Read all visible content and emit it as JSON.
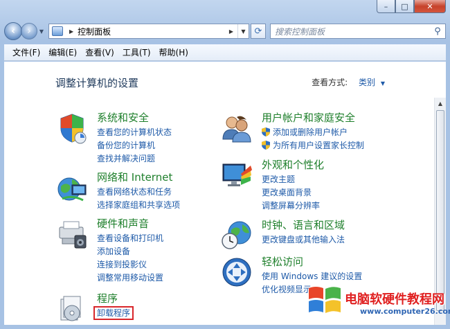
{
  "window": {
    "minimize_glyph": "–",
    "maximize_glyph": "□",
    "close_glyph": "✕"
  },
  "address": {
    "path_text": "控制面板",
    "search_placeholder": "搜索控制面板"
  },
  "menu": [
    "文件(F)",
    "编辑(E)",
    "查看(V)",
    "工具(T)",
    "帮助(H)"
  ],
  "main": {
    "heading": "调整计算机的设置",
    "view_by_label": "查看方式:",
    "view_by_value": "类别"
  },
  "categories": [
    {
      "icon": "system-security-icon",
      "title": "系统和安全",
      "links": [
        "查看您的计算机状态",
        "备份您的计算机",
        "查找并解决问题"
      ]
    },
    {
      "icon": "network-internet-icon",
      "title": "网络和 Internet",
      "links": [
        "查看网络状态和任务",
        "选择家庭组和共享选项"
      ]
    },
    {
      "icon": "hardware-sound-icon",
      "title": "硬件和声音",
      "links": [
        "查看设备和打印机",
        "添加设备",
        "连接到投影仪",
        "调整常用移动设置"
      ]
    },
    {
      "icon": "programs-icon",
      "title": "程序",
      "links": [
        "卸载程序"
      ]
    },
    {
      "icon": "user-accounts-icon",
      "title": "用户帐户和家庭安全",
      "links": [
        "添加或删除用户帐户",
        "为所有用户设置家长控制"
      ]
    },
    {
      "icon": "appearance-icon",
      "title": "外观和个性化",
      "links": [
        "更改主题",
        "更改桌面背景",
        "调整屏幕分辨率"
      ]
    },
    {
      "icon": "clock-region-icon",
      "title": "时钟、语言和区域",
      "links": [
        "更改键盘或其他输入法"
      ]
    },
    {
      "icon": "ease-of-access-icon",
      "title": "轻松访问",
      "links": [
        "使用 Windows 建议的设置",
        "优化视频显示"
      ]
    }
  ],
  "watermark": {
    "main": "电脑软硬件教程网",
    "sub": "www.computer26.com"
  },
  "colors": {
    "category_title": "#1e7f2b",
    "link": "#1e5aa8",
    "highlight_box": "#d8262b"
  }
}
